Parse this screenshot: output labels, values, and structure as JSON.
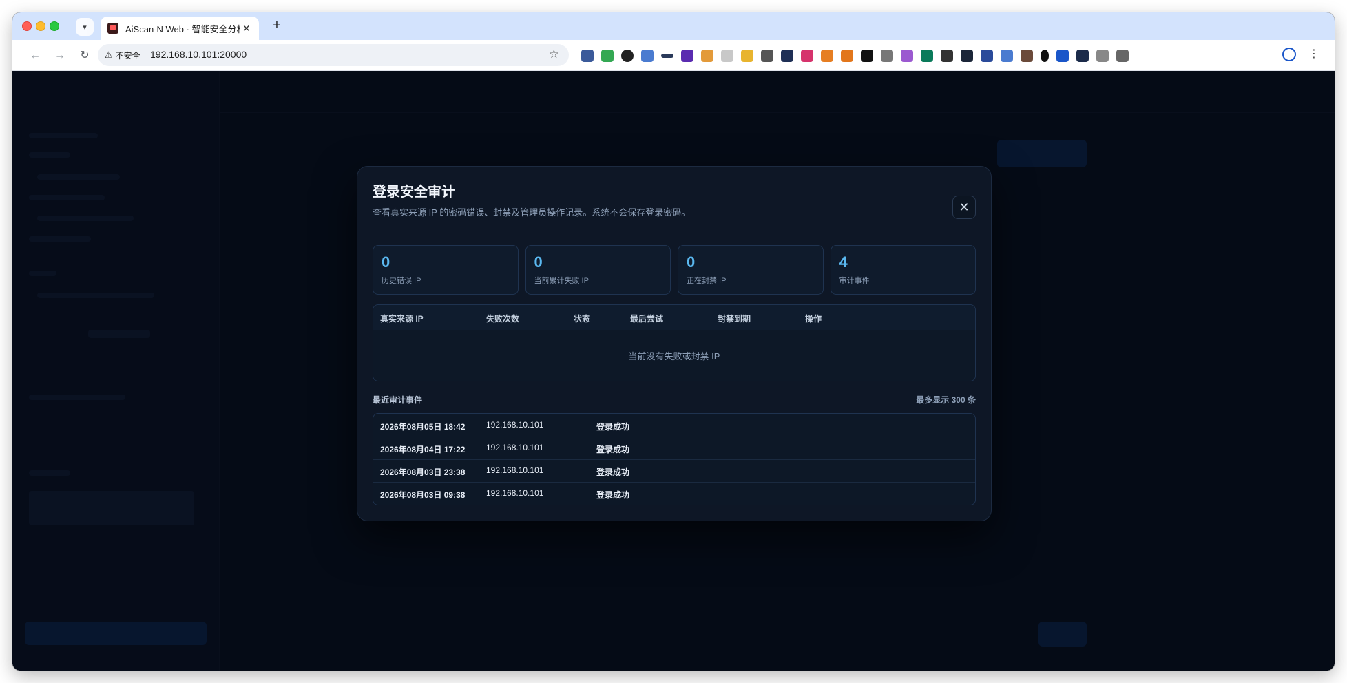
{
  "browser": {
    "tab_title": "AiScan-N Web · 智能安全分析",
    "tab_close": "✕",
    "new_tab": "+",
    "security_label": "不安全",
    "url": "192.168.10.101:20000"
  },
  "modal": {
    "title": "登录安全审计",
    "subtitle": "查看真实来源 IP 的密码错误、封禁及管理员操作记录。系统不会保存登录密码。",
    "close": "✕",
    "stats": [
      {
        "value": "0",
        "label": "历史错误 IP"
      },
      {
        "value": "0",
        "label": "当前累计失败 IP"
      },
      {
        "value": "0",
        "label": "正在封禁 IP"
      },
      {
        "value": "4",
        "label": "审计事件"
      }
    ],
    "table": {
      "headers": [
        "真实来源 IP",
        "失败次数",
        "状态",
        "最后尝试",
        "封禁到期",
        "操作"
      ],
      "empty_text": "当前没有失败或封禁 IP"
    },
    "events_title": "最近审计事件",
    "events_max": "最多显示 300 条",
    "events": [
      {
        "time": "2026年08月05日 18:42",
        "ip": "192.168.10.101",
        "status": "登录成功"
      },
      {
        "time": "2026年08月04日 17:22",
        "ip": "192.168.10.101",
        "status": "登录成功"
      },
      {
        "time": "2026年08月03日 23:38",
        "ip": "192.168.10.101",
        "status": "登录成功"
      },
      {
        "time": "2026年08月03日 09:38",
        "ip": "192.168.10.101",
        "status": "登录成功"
      }
    ]
  },
  "colors": {
    "accent": "#5ab8f0",
    "modal_bg": "#0e1726",
    "page_bg": "#0b1220"
  }
}
